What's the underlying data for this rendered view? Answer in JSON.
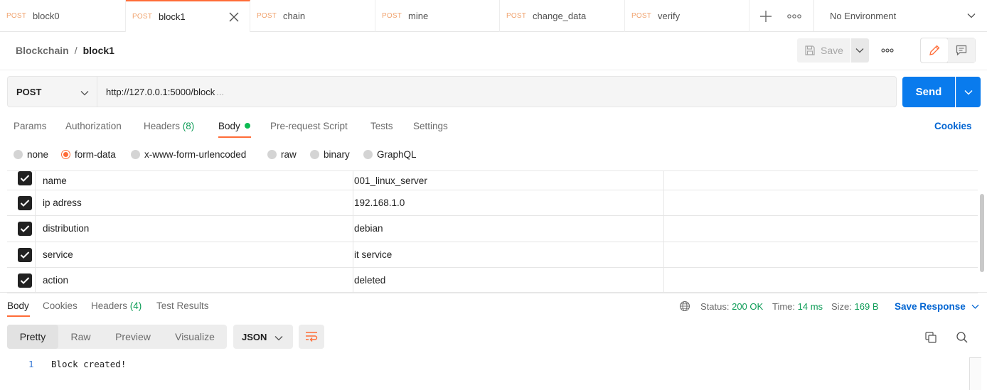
{
  "tabs": [
    {
      "method": "POST",
      "name": "block0",
      "active": false
    },
    {
      "method": "POST",
      "name": "block1",
      "active": true
    },
    {
      "method": "POST",
      "name": "chain",
      "active": false
    },
    {
      "method": "POST",
      "name": "mine",
      "active": false
    },
    {
      "method": "POST",
      "name": "change_data",
      "active": false
    },
    {
      "method": "POST",
      "name": "verify",
      "active": false
    }
  ],
  "environment": {
    "label": "No Environment"
  },
  "breadcrumb": {
    "collection": "Blockchain",
    "separator": "/",
    "request": "block1"
  },
  "toolbar": {
    "save_label": "Save"
  },
  "request": {
    "method": "POST",
    "url": "http://127.0.0.1:5000/block",
    "url_ellipsis": "...",
    "send_label": "Send"
  },
  "request_tabs": {
    "params": "Params",
    "authorization": "Authorization",
    "headers": "Headers",
    "headers_count": "(8)",
    "body": "Body",
    "prerequest": "Pre-request Script",
    "tests": "Tests",
    "settings": "Settings",
    "cookies": "Cookies"
  },
  "body_types": {
    "none": "none",
    "form_data": "form-data",
    "urlencoded": "x-www-form-urlencoded",
    "raw": "raw",
    "binary": "binary",
    "graphql": "GraphQL",
    "selected": "form-data"
  },
  "form_data": [
    {
      "key": "name",
      "value": "001_linux_server",
      "checked": true
    },
    {
      "key": "ip adress",
      "value": "192.168.1.0",
      "checked": true
    },
    {
      "key": "distribution",
      "value": "debian",
      "checked": true
    },
    {
      "key": "service",
      "value": "it service",
      "checked": true
    },
    {
      "key": "action",
      "value": "deleted",
      "checked": true
    }
  ],
  "response_tabs": {
    "body": "Body",
    "cookies": "Cookies",
    "headers": "Headers",
    "headers_count": "(4)",
    "test_results": "Test Results"
  },
  "response_meta": {
    "status_label": "Status:",
    "status_value": "200 OK",
    "time_label": "Time:",
    "time_value": "14 ms",
    "size_label": "Size:",
    "size_value": "169 B",
    "save_response": "Save Response"
  },
  "response_view": {
    "pretty": "Pretty",
    "raw": "Raw",
    "preview": "Preview",
    "visualize": "Visualize",
    "format": "JSON"
  },
  "response_body": [
    {
      "line": "1",
      "text": "Block created!"
    }
  ],
  "colors": {
    "accent": "#ff6c37",
    "send": "#097bed",
    "link": "#0265d2",
    "success": "#0f9d58"
  }
}
